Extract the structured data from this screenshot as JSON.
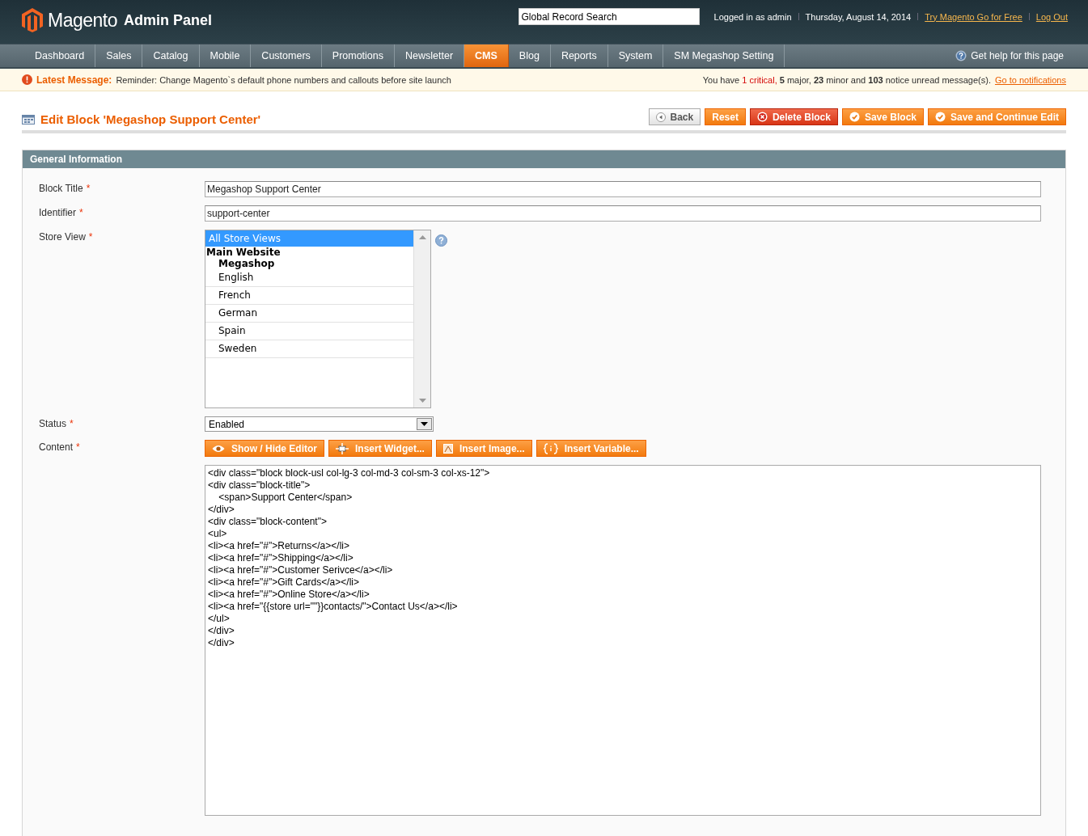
{
  "header": {
    "logo": "Magento",
    "logo_suffix": "Admin Panel",
    "search": {
      "value": "Global Record Search"
    },
    "user": "Logged in as admin",
    "date": "Thursday, August 14, 2014",
    "links": [
      "Try Magento Go for Free",
      "Log Out"
    ]
  },
  "nav": {
    "items": [
      {
        "label": "Dashboard",
        "selected": false
      },
      {
        "label": "Sales",
        "selected": false
      },
      {
        "label": "Catalog",
        "selected": false
      },
      {
        "label": "Mobile",
        "selected": false
      },
      {
        "label": "Customers",
        "selected": false
      },
      {
        "label": "Promotions",
        "selected": false
      },
      {
        "label": "Newsletter",
        "selected": false
      },
      {
        "label": "CMS",
        "selected": true
      },
      {
        "label": "Blog",
        "selected": false
      },
      {
        "label": "Reports",
        "selected": false
      },
      {
        "label": "System",
        "selected": false
      },
      {
        "label": "SM Megashop Setting",
        "selected": false
      }
    ],
    "help": "Get help for this page"
  },
  "message": {
    "label": "Latest Message:",
    "text": "Reminder: Change Magento`s default phone numbers and callouts before site launch",
    "summary": [
      {
        "kind": "plain",
        "text": "You have"
      },
      {
        "kind": "critical",
        "text": "1"
      },
      {
        "kind": "critical",
        "text": "critical,"
      },
      {
        "kind": "bold",
        "text": "5"
      },
      {
        "kind": "plain",
        "text": "major,"
      },
      {
        "kind": "bold",
        "text": "23"
      },
      {
        "kind": "plain",
        "text": "minor and"
      },
      {
        "kind": "bold",
        "text": "103"
      },
      {
        "kind": "plain",
        "text": "notice unread message(s)."
      }
    ],
    "link": "Go to notifications"
  },
  "page": {
    "title": "Edit Block 'Megashop Support Center'",
    "buttons": [
      {
        "kind": "back",
        "label": "Back"
      },
      {
        "kind": "reset",
        "label": "Reset"
      },
      {
        "kind": "delete",
        "label": "Delete Block"
      },
      {
        "kind": "save",
        "label": "Save Block"
      },
      {
        "kind": "save",
        "label": "Save and Continue Edit"
      }
    ]
  },
  "section": {
    "title": "General Information",
    "fields": [
      {
        "kind": "text",
        "label": "Block Title",
        "required": "*",
        "value": "Megashop Support Center"
      },
      {
        "kind": "text",
        "label": "Identifier",
        "required": "*",
        "value": "support-center"
      },
      {
        "kind": "multiselect",
        "label": "Store View",
        "required": "*",
        "options": [
          {
            "label": "All Store Views",
            "selected": true
          },
          {
            "label": "Main Website",
            "selected": false,
            "children": [
              {
                "label": "Megashop",
                "selected": false,
                "children": [
                  {
                    "label": "English",
                    "selected": false
                  },
                  {
                    "label": "French",
                    "selected": false
                  },
                  {
                    "label": "German",
                    "selected": false
                  },
                  {
                    "label": "Spain",
                    "selected": false
                  },
                  {
                    "label": "Sweden",
                    "selected": false
                  }
                ]
              }
            ]
          }
        ]
      },
      {
        "kind": "select",
        "label": "Status",
        "required": "*",
        "value": "Enabled"
      },
      {
        "kind": "content",
        "label": "Content",
        "required": "*",
        "buttons": [
          {
            "kind": "eye",
            "label": "Show / Hide Editor"
          },
          {
            "kind": "widget",
            "label": "Insert Widget..."
          },
          {
            "kind": "image",
            "label": "Insert Image..."
          },
          {
            "kind": "variable",
            "label": "Insert Variable..."
          }
        ],
        "value": "<div class=\"block block-usl col-lg-3 col-md-3 col-sm-3 col-xs-12\">\n<div class=\"block-title\">\n\t<span>Support Center</span>\n</div>\n<div class=\"block-content\">\n<ul>\n<li><a href=\"#\">Returns</a></li>\n<li><a href=\"#\">Shipping</a></li>\n<li><a href=\"#\">Customer Serivce</a></li>\n<li><a href=\"#\">Gift Cards</a></li>\n<li><a href=\"#\">Online Store</a></li>\n<li><a href=\"{{store url=\"\"}}contacts/\">Contact Us</a></li>\n</ul>\n</div>\n</div>"
      }
    ]
  }
}
